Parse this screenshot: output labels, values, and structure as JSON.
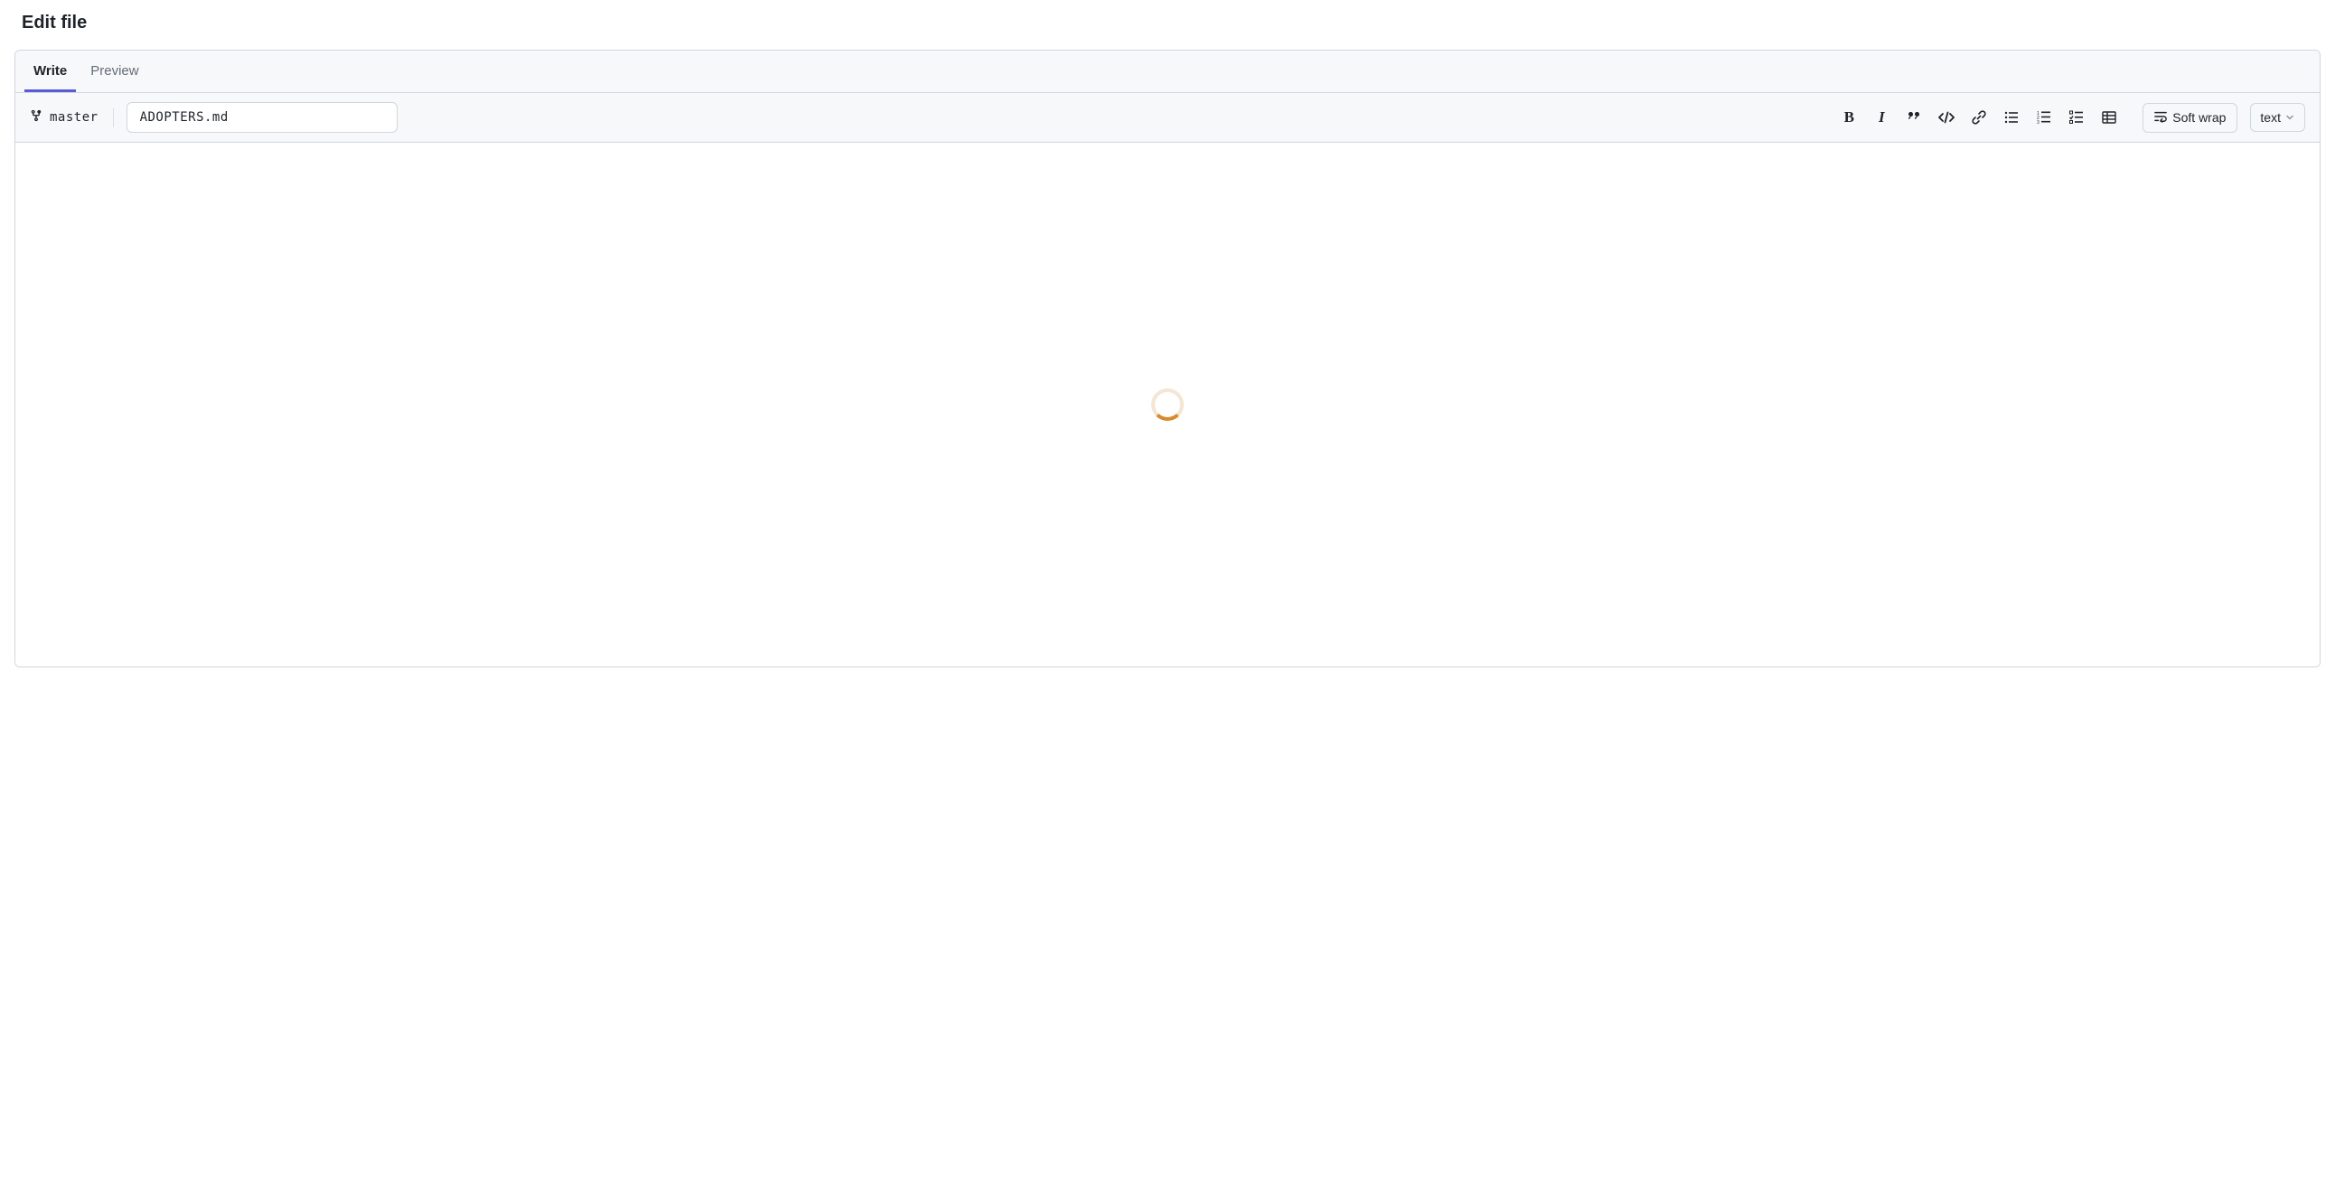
{
  "page": {
    "title": "Edit file"
  },
  "tabs": {
    "write": "Write",
    "preview": "Preview",
    "active": "write"
  },
  "branch": {
    "name": "master"
  },
  "file": {
    "name": "ADOPTERS.md"
  },
  "toolbar": {
    "bold_label": "B",
    "italic_label": "I",
    "soft_wrap_label": "Soft wrap",
    "filetype_label": "text"
  }
}
